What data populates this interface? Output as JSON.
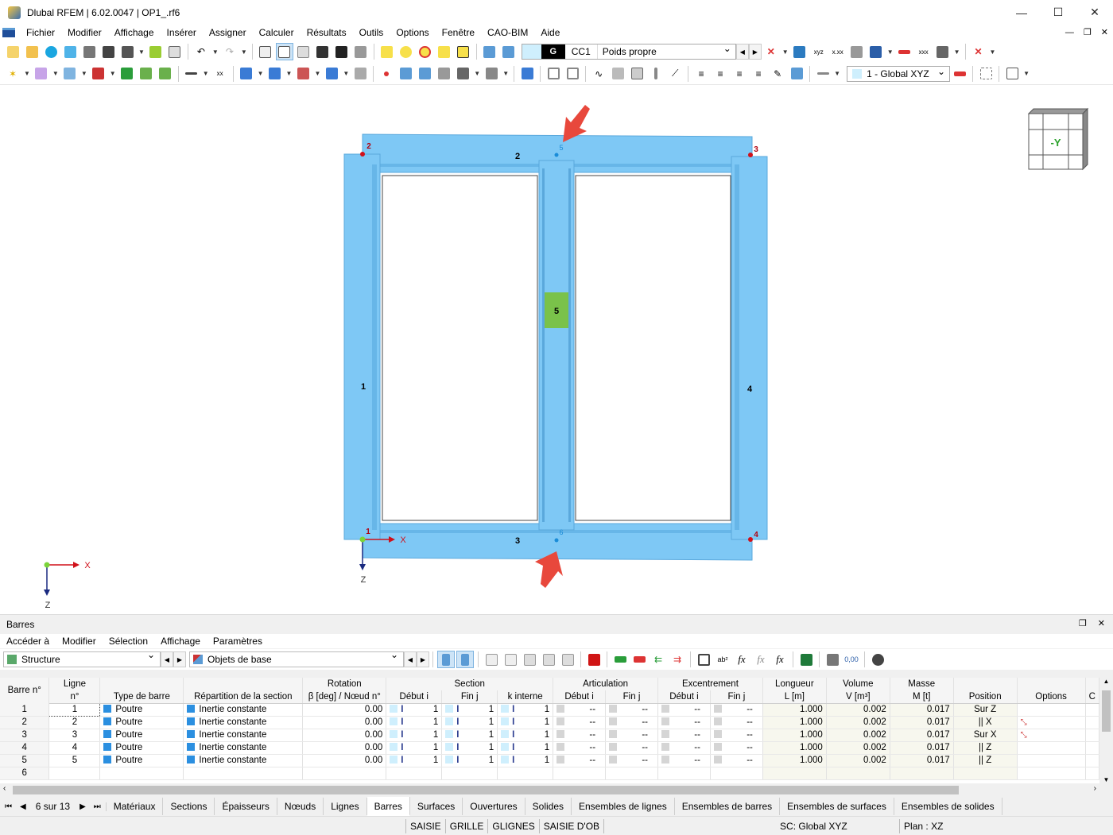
{
  "window": {
    "title": "Dlubal RFEM | 6.02.0047 | OP1_.rf6",
    "min": "—",
    "max": "☐",
    "close": "✕"
  },
  "menu": [
    "Fichier",
    "Modifier",
    "Affichage",
    "Insérer",
    "Assigner",
    "Calculer",
    "Résultats",
    "Outils",
    "Options",
    "Fenêtre",
    "CAO-BIM",
    "Aide"
  ],
  "load_case": {
    "type": "G",
    "code": "CC1",
    "name": "Poids propre"
  },
  "coord_system": "1 - Global XYZ",
  "colors": {
    "member": "#7ec8f5",
    "member_edge": "#5aa8dc",
    "node": "#d0101a",
    "label_member5": "#7ac24a",
    "arrow": "#e8483c"
  },
  "view": {
    "cube_label": "-Y",
    "members": [
      "1",
      "2",
      "3",
      "4",
      "5"
    ],
    "nodes": [
      "1",
      "2",
      "3",
      "4",
      "5",
      "6"
    ],
    "axis_x": "X",
    "axis_z": "Z"
  },
  "panel": {
    "title": "Barres",
    "menu": [
      "Accéder à",
      "Modifier",
      "Sélection",
      "Affichage",
      "Paramètres"
    ],
    "combo1": "Structure",
    "combo2": "Objets de base",
    "headers_top": {
      "barre": "Barre n°",
      "ligne": "Ligne",
      "rotation": "Rotation",
      "section": "Section",
      "articulation": "Articulation",
      "excentrement": "Excentrement",
      "longueur": "Longueur",
      "volume": "Volume",
      "masse": "Masse"
    },
    "headers_bottom": {
      "ligne": "n°",
      "type": "Type de barre",
      "repartition": "Répartition de la section",
      "rotation": "β [deg] / Nœud n°",
      "debut": "Début i",
      "fin": "Fin j",
      "interne": "k interne",
      "art_debut": "Début i",
      "art_fin": "Fin j",
      "exc_debut": "Début i",
      "exc_fin": "Fin j",
      "longueur": "L [m]",
      "volume": "V [m³]",
      "masse": "M [t]",
      "position": "Position",
      "options": "Options",
      "c": "C"
    },
    "rows": [
      {
        "n": "1",
        "ligne": "1",
        "type": "Poutre",
        "rep": "Inertie constante",
        "rot": "0.00",
        "si": "1",
        "sj": "1",
        "sk": "1",
        "ai": "--",
        "aj": "--",
        "ei": "--",
        "ej": "--",
        "L": "1.000",
        "V": "0.002",
        "M": "0.017",
        "pos": "Sur Z"
      },
      {
        "n": "2",
        "ligne": "2",
        "type": "Poutre",
        "rep": "Inertie constante",
        "rot": "0.00",
        "si": "1",
        "sj": "1",
        "sk": "1",
        "ai": "--",
        "aj": "--",
        "ei": "--",
        "ej": "--",
        "L": "1.000",
        "V": "0.002",
        "M": "0.017",
        "pos": "|| X"
      },
      {
        "n": "3",
        "ligne": "3",
        "type": "Poutre",
        "rep": "Inertie constante",
        "rot": "0.00",
        "si": "1",
        "sj": "1",
        "sk": "1",
        "ai": "--",
        "aj": "--",
        "ei": "--",
        "ej": "--",
        "L": "1.000",
        "V": "0.002",
        "M": "0.017",
        "pos": "Sur X"
      },
      {
        "n": "4",
        "ligne": "4",
        "type": "Poutre",
        "rep": "Inertie constante",
        "rot": "0.00",
        "si": "1",
        "sj": "1",
        "sk": "1",
        "ai": "--",
        "aj": "--",
        "ei": "--",
        "ej": "--",
        "L": "1.000",
        "V": "0.002",
        "M": "0.017",
        "pos": "|| Z"
      },
      {
        "n": "5",
        "ligne": "5",
        "type": "Poutre",
        "rep": "Inertie constante",
        "rot": "0.00",
        "si": "1",
        "sj": "1",
        "sk": "1",
        "ai": "--",
        "aj": "--",
        "ei": "--",
        "ej": "--",
        "L": "1.000",
        "V": "0.002",
        "M": "0.017",
        "pos": "|| Z"
      },
      {
        "n": "6"
      }
    ],
    "pager": "6 sur 13",
    "tabs": [
      "Matériaux",
      "Sections",
      "Épaisseurs",
      "Nœuds",
      "Lignes",
      "Barres",
      "Surfaces",
      "Ouvertures",
      "Solides",
      "Ensembles de lignes",
      "Ensembles de barres",
      "Ensembles de surfaces",
      "Ensembles de solides"
    ],
    "active_tab": "Barres"
  },
  "status": {
    "items": [
      "SAISIE",
      "GRILLE",
      "GLIGNES",
      "SAISIE D'OB"
    ],
    "sc": "SC: Global XYZ",
    "plan": "Plan : XZ"
  }
}
